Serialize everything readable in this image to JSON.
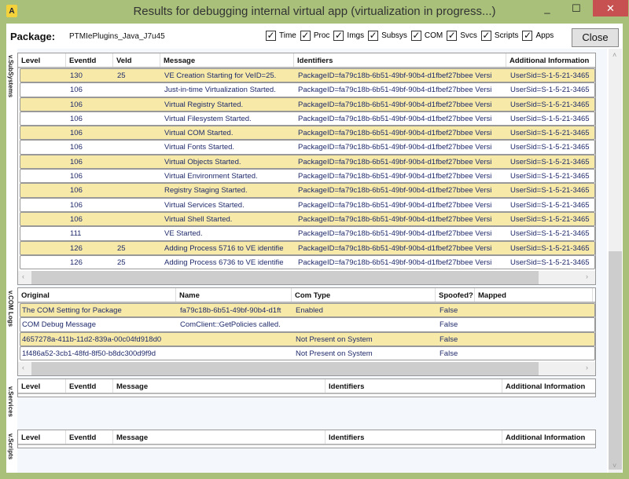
{
  "window": {
    "title": "Results for debugging internal virtual app (virtualization in progress...)",
    "minimize": "_",
    "maximize": "☐",
    "close": "✕",
    "app_icon": "A"
  },
  "toolbar": {
    "package_label": "Package:",
    "package_value": "PTMIePlugins_Java_J7u45",
    "close_label": "Close",
    "checkboxes": [
      {
        "label": "Time",
        "checked": true
      },
      {
        "label": "Proc",
        "checked": true
      },
      {
        "label": "Imgs",
        "checked": true
      },
      {
        "label": "Subsys",
        "checked": true
      },
      {
        "label": "COM",
        "checked": true
      },
      {
        "label": "Svcs",
        "checked": true
      },
      {
        "label": "Scripts",
        "checked": true
      },
      {
        "label": "Apps",
        "checked": true
      }
    ]
  },
  "subsystems": {
    "label": "v.SubSystems",
    "columns": [
      "Level",
      "EventId",
      "VeId",
      "Message",
      "Identifiers",
      "Additional Information"
    ],
    "rows": [
      [
        "",
        "130",
        "25",
        "VE Creation Starting for VeID=25.",
        "PackageID=fa79c18b-6b51-49bf-90b4-d1fbef27bbee Versi",
        "UserSid=S-1-5-21-3465"
      ],
      [
        "",
        "106",
        "",
        "Just-in-time Virtualization Started.",
        "PackageID=fa79c18b-6b51-49bf-90b4-d1fbef27bbee Versi",
        "UserSid=S-1-5-21-3465"
      ],
      [
        "",
        "106",
        "",
        "Virtual Registry Started.",
        "PackageID=fa79c18b-6b51-49bf-90b4-d1fbef27bbee Versi",
        "UserSid=S-1-5-21-3465"
      ],
      [
        "",
        "106",
        "",
        "Virtual Filesystem Started.",
        "PackageID=fa79c18b-6b51-49bf-90b4-d1fbef27bbee Versi",
        "UserSid=S-1-5-21-3465"
      ],
      [
        "",
        "106",
        "",
        "Virtual COM Started.",
        "PackageID=fa79c18b-6b51-49bf-90b4-d1fbef27bbee Versi",
        "UserSid=S-1-5-21-3465"
      ],
      [
        "",
        "106",
        "",
        "Virtual Fonts Started.",
        "PackageID=fa79c18b-6b51-49bf-90b4-d1fbef27bbee Versi",
        "UserSid=S-1-5-21-3465"
      ],
      [
        "",
        "106",
        "",
        "Virtual Objects Started.",
        "PackageID=fa79c18b-6b51-49bf-90b4-d1fbef27bbee Versi",
        "UserSid=S-1-5-21-3465"
      ],
      [
        "",
        "106",
        "",
        "Virtual Environment Started.",
        "PackageID=fa79c18b-6b51-49bf-90b4-d1fbef27bbee Versi",
        "UserSid=S-1-5-21-3465"
      ],
      [
        "",
        "106",
        "",
        "Registry Staging Started.",
        "PackageID=fa79c18b-6b51-49bf-90b4-d1fbef27bbee Versi",
        "UserSid=S-1-5-21-3465"
      ],
      [
        "",
        "106",
        "",
        "Virtual Services Started.",
        "PackageID=fa79c18b-6b51-49bf-90b4-d1fbef27bbee Versi",
        "UserSid=S-1-5-21-3465"
      ],
      [
        "",
        "106",
        "",
        "Virtual Shell Started.",
        "PackageID=fa79c18b-6b51-49bf-90b4-d1fbef27bbee Versi",
        "UserSid=S-1-5-21-3465"
      ],
      [
        "",
        "111",
        "",
        "VE Started.",
        "PackageID=fa79c18b-6b51-49bf-90b4-d1fbef27bbee Versi",
        "UserSid=S-1-5-21-3465"
      ],
      [
        "",
        "126",
        "25",
        "Adding Process 5716 to VE identifie",
        "PackageID=fa79c18b-6b51-49bf-90b4-d1fbef27bbee Versi",
        "UserSid=S-1-5-21-3465"
      ],
      [
        "",
        "126",
        "25",
        "Adding Process 6736 to VE identifie",
        "PackageID=fa79c18b-6b51-49bf-90b4-d1fbef27bbee Versi",
        "UserSid=S-1-5-21-3465"
      ]
    ]
  },
  "com_logs": {
    "label": "v.COM Logs",
    "columns": [
      "Original",
      "Name",
      "Com Type",
      "Spoofed?",
      "Mapped"
    ],
    "rows": [
      [
        "The COM Setting for Package",
        "fa79c18b-6b51-49bf-90b4-d1ft",
        "Enabled",
        "False",
        ""
      ],
      [
        "COM Debug Message",
        "ComClient::GetPolicies called.",
        "",
        "False",
        ""
      ],
      [
        "4657278a-411b-11d2-839a-00c04fd918d0",
        "",
        "Not Present on System",
        "False",
        ""
      ],
      [
        "1f486a52-3cb1-48fd-8f50-b8dc300d9f9d",
        "",
        "Not Present on System",
        "False",
        ""
      ]
    ]
  },
  "services": {
    "label": "v.Services",
    "columns": [
      "Level",
      "EventId",
      "Message",
      "Identifiers",
      "Additional Information"
    ]
  },
  "scripts": {
    "label": "v.Scripts",
    "columns": [
      "Level",
      "EventId",
      "Message",
      "Identifiers",
      "Additional Information"
    ]
  },
  "colors": {
    "frame": "#a9c07a",
    "row_highlight": "#f7eaa8",
    "close_red": "#c75050",
    "text": "#1f2a6b"
  }
}
